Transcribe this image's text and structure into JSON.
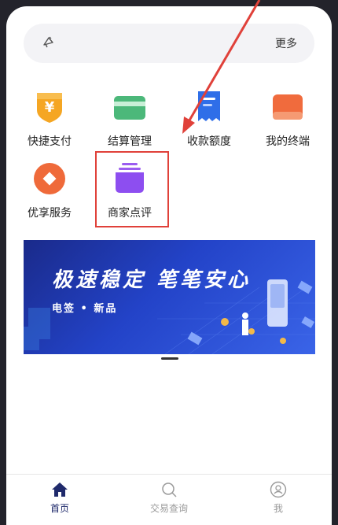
{
  "notice": {
    "more_label": "更多"
  },
  "grid": [
    {
      "label": "快捷支付",
      "icon": "yuan-shield-icon"
    },
    {
      "label": "结算管理",
      "icon": "card-icon"
    },
    {
      "label": "收款额度",
      "icon": "receipt-icon"
    },
    {
      "label": "我的终端",
      "icon": "terminal-icon"
    },
    {
      "label": "优享服务",
      "icon": "privilege-icon"
    },
    {
      "label": "商家点评",
      "icon": "merchant-review-icon"
    }
  ],
  "banner": {
    "headline": "极速稳定 笔笔安心",
    "subtitle": "电签 • 新品"
  },
  "tabs": [
    {
      "label": "首页",
      "icon": "home-icon",
      "active": true
    },
    {
      "label": "交易查询",
      "icon": "search-icon",
      "active": false
    },
    {
      "label": "我",
      "icon": "user-icon",
      "active": false
    }
  ],
  "colors": {
    "accent": "#1f2a6b",
    "highlight": "#e0413a",
    "tab_inactive": "#9a9a9a"
  }
}
